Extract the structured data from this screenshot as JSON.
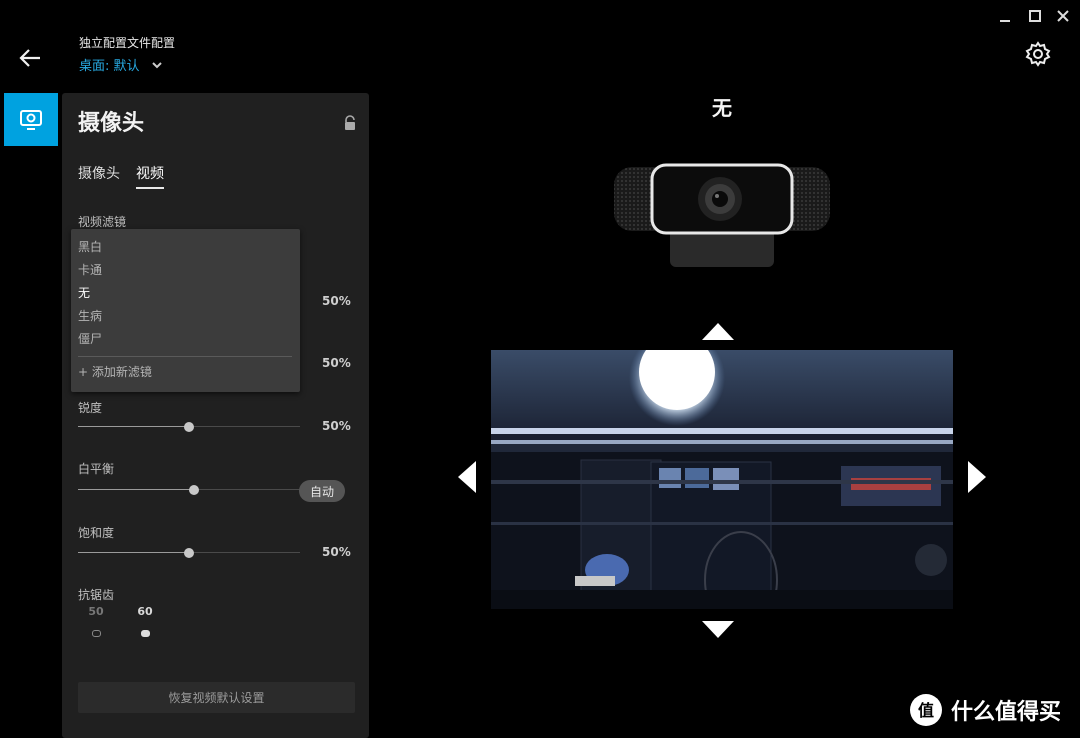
{
  "header": {
    "profile_label": "独立配置文件配置",
    "profile_value": "桌面: 默认"
  },
  "panel": {
    "title": "摄像头",
    "tabs": [
      "摄像头",
      "视频"
    ],
    "active_tab": "视频"
  },
  "filter": {
    "label": "视频滤镜",
    "options": [
      "黑白",
      "卡通",
      "无",
      "生病",
      "僵尸"
    ],
    "selected": "无",
    "add_label": "+ 添加新滤镜"
  },
  "settings": {
    "hidden_value_1": "50%",
    "hidden_value_2": "50%",
    "sharpness": {
      "label": "锐度",
      "value": "50%",
      "level": 0.5
    },
    "white_balance": {
      "label": "白平衡",
      "auto_label": "自动",
      "level": 0.5
    },
    "saturation": {
      "label": "饱和度",
      "value": "50%",
      "level": 0.5
    },
    "antiflicker": {
      "label": "抗锯齿",
      "options": [
        "50",
        "60"
      ],
      "selected": "60"
    },
    "reset_label": "恢复视频默认设置"
  },
  "preview": {
    "filter_name": "无"
  },
  "watermark": {
    "text": "什么值得买",
    "badge": "值"
  },
  "colors": {
    "accent": "#00a2e0",
    "link": "#27a9e1",
    "panel": "#202020",
    "background": "#000000"
  },
  "icons": [
    "minimize-icon",
    "maximize-icon",
    "close-icon",
    "back-arrow-icon",
    "chevron-down-icon",
    "gear-icon",
    "camera-icon",
    "lock-icon"
  ]
}
